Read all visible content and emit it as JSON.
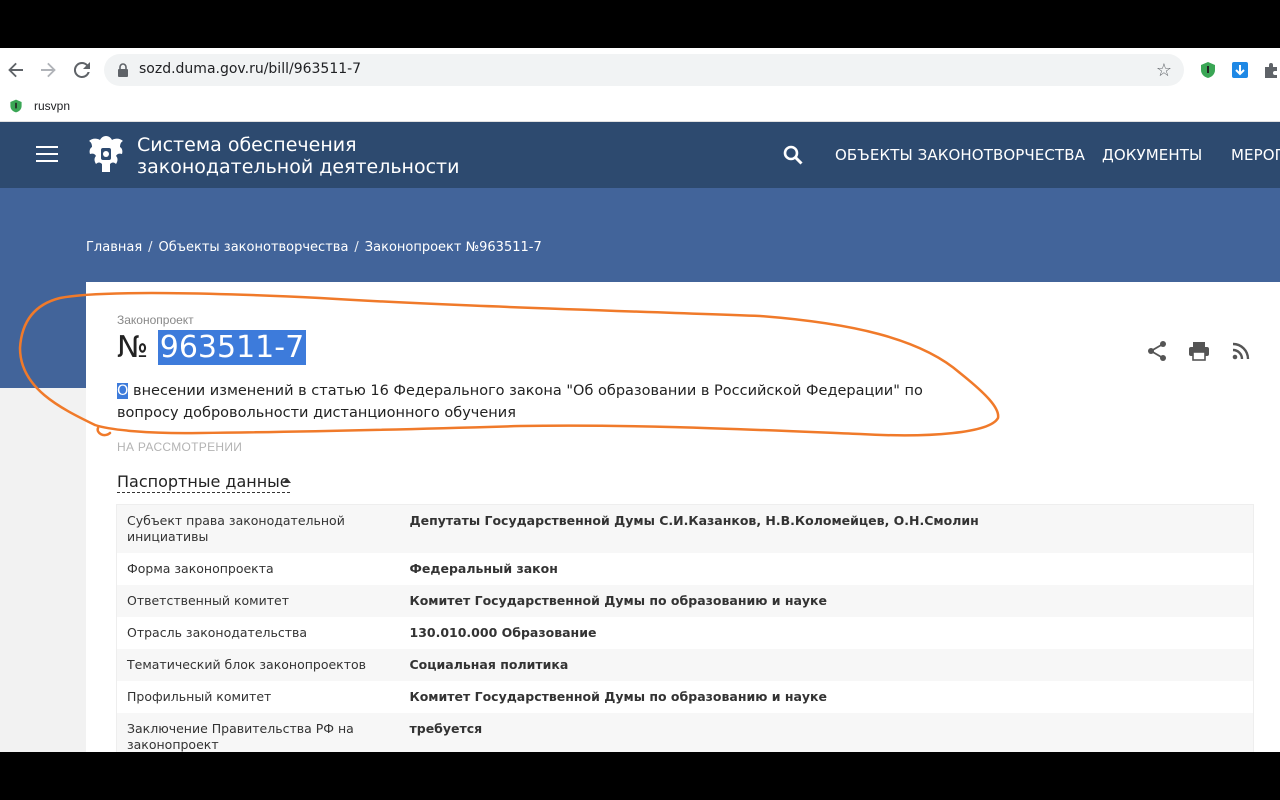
{
  "browser": {
    "url": "sozd.duma.gov.ru/bill/963511-7",
    "bookmark_label": "rusvpn"
  },
  "header": {
    "title_line1": "Система обеспечения",
    "title_line2": "законодательной деятельности",
    "nav": [
      "ОБЪЕКТЫ ЗАКОНОТВОРЧЕСТВА",
      "ДОКУМЕНТЫ",
      "МЕРОП"
    ],
    "color": "#2d4a6f"
  },
  "breadcrumb": [
    "Главная",
    "Объекты законотворчества",
    "Законопроект №963511-7"
  ],
  "bill": {
    "type_label": "Законопроект",
    "number_prefix": "№ ",
    "number": "963511-7",
    "title_first_char": "О",
    "title_rest": " внесении изменений в статью 16 Федерального закона \"Об образовании в Российской Федерации\" по вопросу добровольности дистанционного обучения",
    "status": "НА РАССМОТРЕНИИ"
  },
  "passport": {
    "toggle_label": "Паспортные данные",
    "rows": [
      {
        "key": "Субъект права законодательной инициативы",
        "value": "Депутаты Государственной Думы С.И.Казанков, Н.В.Коломейцев, О.Н.Смолин"
      },
      {
        "key": "Форма законопроекта",
        "value": "Федеральный закон"
      },
      {
        "key": "Ответственный комитет",
        "value": "Комитет Государственной Думы по образованию и науке"
      },
      {
        "key": "Отрасль законодательства",
        "value": "130.010.000 Образование"
      },
      {
        "key": "Тематический блок законопроектов",
        "value": "Социальная политика"
      },
      {
        "key": "Профильный комитет",
        "value": "Комитет Государственной Думы по образованию и науке"
      },
      {
        "key": "Заключение Правительства РФ на законопроект",
        "value": "требуется"
      }
    ]
  },
  "icons": {
    "share": "share-icon",
    "print": "print-icon",
    "rss": "rss-icon"
  },
  "annotation_color": "#f07a2a",
  "selection_color": "#3d7bdb"
}
